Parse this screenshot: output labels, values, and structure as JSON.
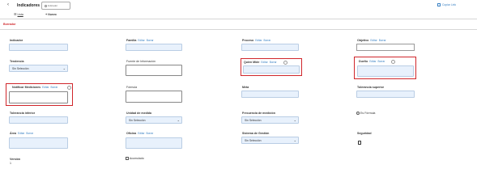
{
  "header": {
    "back_icon": "chevron-left-icon",
    "title": "Indicadores",
    "badge": "Indicador",
    "copy_link": "Copiar Link"
  },
  "toolbar": {
    "list_label": "Lista",
    "new_label": "Nuevo"
  },
  "status": "Borrador",
  "field_links": {
    "edit": "Editar",
    "clear": "Borrar"
  },
  "fields": {
    "indicador": "Indicador",
    "familia": "Familia",
    "proceso": "Proceso",
    "objetivo": "Objetivo",
    "tendencia": "Tendencia",
    "tendencia_value": "Sin Selección",
    "fuente": "Fuente de Información",
    "quien_mide": "Quien Mide",
    "dueno": "Dueño",
    "notificar": "Notificar Mediciones",
    "formula": "Fórmula",
    "meta": "Meta",
    "tol_sup": "Tolerancia superior",
    "tol_inf": "Tolerancia inferior",
    "unidad": "Unidad de medida",
    "unidad_value": "Sin Selección",
    "frecuencia": "Frecuencia de medición",
    "frecuencia_value": "Sin Selección",
    "es_formula": "Es Fórmula",
    "area": "Área",
    "oficina": "Oficina",
    "sistema": "Sistema de Gestión",
    "sistema_value": "Sin Selección",
    "seguridad": "Seguridad",
    "version": "Versión",
    "version_value": "1",
    "acumulado": "Acumulado"
  },
  "colors": {
    "highlight": "#d0262b",
    "link": "#3b82c4",
    "input_bg": "#e8f1fc",
    "status": "#d0262b"
  }
}
